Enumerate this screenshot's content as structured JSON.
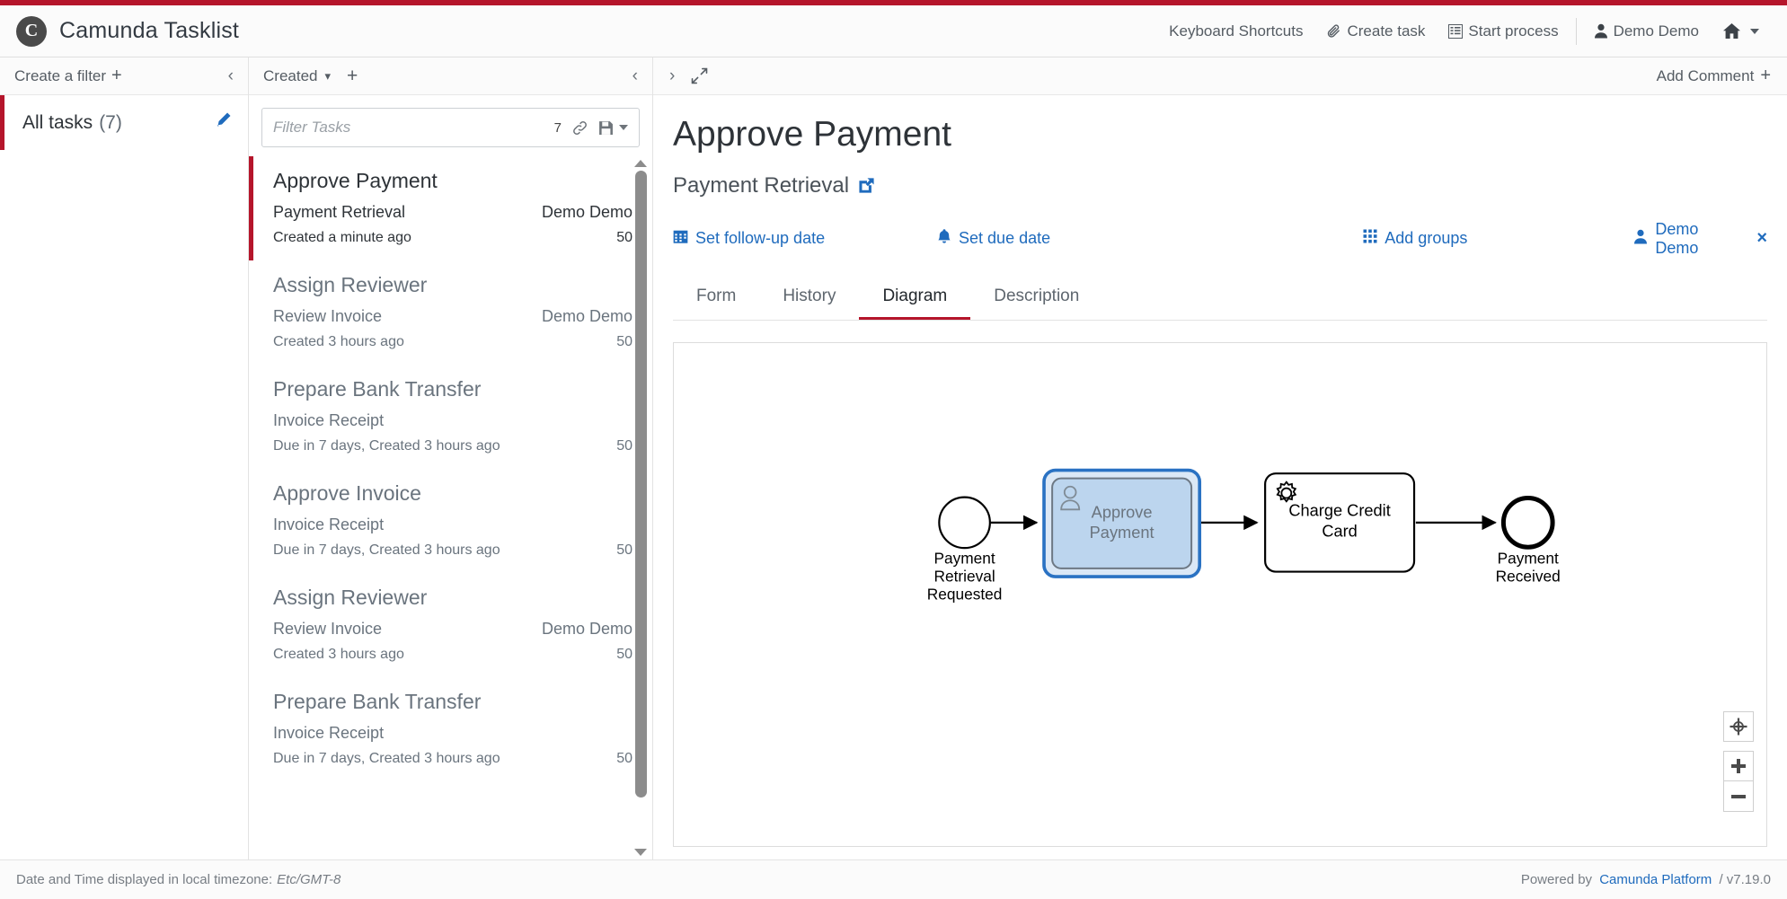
{
  "app": {
    "brand_title": "Camunda Tasklist",
    "logo_glyph": "C",
    "accent_red": "#b5152b",
    "link_blue": "#1f6bbd"
  },
  "header": {
    "keyboard_shortcuts": "Keyboard Shortcuts",
    "create_task": "Create task",
    "start_process": "Start process",
    "user": "Demo Demo"
  },
  "filters": {
    "create_filter_label": "Create a filter",
    "plus": "+",
    "collapse": "‹",
    "items": [
      {
        "name": "All tasks",
        "count": "(7)"
      }
    ]
  },
  "tasklist": {
    "sort_label": "Created",
    "add_label": "+",
    "collapse": "‹",
    "search": {
      "placeholder": "Filter Tasks",
      "value": "",
      "count": "7"
    },
    "tasks": [
      {
        "title": "Approve Payment",
        "process": "Payment Retrieval",
        "assignee": "Demo Demo",
        "meta": "Created a minute ago",
        "priority": "50",
        "selected": true
      },
      {
        "title": "Assign Reviewer",
        "process": "Review Invoice",
        "assignee": "Demo Demo",
        "meta": "Created 3 hours ago",
        "priority": "50",
        "selected": false
      },
      {
        "title": "Prepare Bank Transfer",
        "process": "Invoice Receipt",
        "assignee": "",
        "meta": "Due in 7 days, Created 3 hours ago",
        "priority": "50",
        "selected": false
      },
      {
        "title": "Approve Invoice",
        "process": "Invoice Receipt",
        "assignee": "",
        "meta": "Due in 7 days, Created 3 hours ago",
        "priority": "50",
        "selected": false
      },
      {
        "title": "Assign Reviewer",
        "process": "Review Invoice",
        "assignee": "Demo Demo",
        "meta": "Created 3 hours ago",
        "priority": "50",
        "selected": false
      },
      {
        "title": "Prepare Bank Transfer",
        "process": "Invoice Receipt",
        "assignee": "",
        "meta": "Due in 7 days, Created 3 hours ago",
        "priority": "50",
        "selected": false
      }
    ]
  },
  "detail": {
    "expand_chevron": "›",
    "add_comment": "Add Comment",
    "add_comment_plus": "+",
    "task_title": "Approve Payment",
    "process_name": "Payment Retrieval",
    "actions": {
      "set_followup": "Set follow-up date",
      "set_due": "Set due date",
      "add_groups": "Add groups",
      "assignee": "Demo Demo",
      "remove": "×"
    },
    "tabs": [
      {
        "label": "Form",
        "active": false
      },
      {
        "label": "History",
        "active": false
      },
      {
        "label": "Diagram",
        "active": true
      },
      {
        "label": "Description",
        "active": false
      }
    ]
  },
  "diagram": {
    "type": "bpmn",
    "elements": [
      {
        "id": "start",
        "kind": "start-event",
        "label": "Payment Retrieval Requested"
      },
      {
        "id": "approve",
        "kind": "user-task",
        "label": "Approve Payment",
        "highlighted": true
      },
      {
        "id": "charge",
        "kind": "service-task",
        "label": "Charge Credit Card",
        "highlighted": false
      },
      {
        "id": "end",
        "kind": "end-event",
        "label": "Payment Received"
      }
    ],
    "flows": [
      {
        "from": "start",
        "to": "approve"
      },
      {
        "from": "approve",
        "to": "charge"
      },
      {
        "from": "charge",
        "to": "end"
      }
    ],
    "highlight_fill": "#bcd5ee",
    "highlight_stroke": "#2a72c3"
  },
  "footer": {
    "timezone_prefix": "Date and Time displayed in local timezone:",
    "timezone": "Etc/GMT-8",
    "powered_by": "Powered by",
    "platform": "Camunda Platform",
    "version": "/ v7.19.0"
  }
}
